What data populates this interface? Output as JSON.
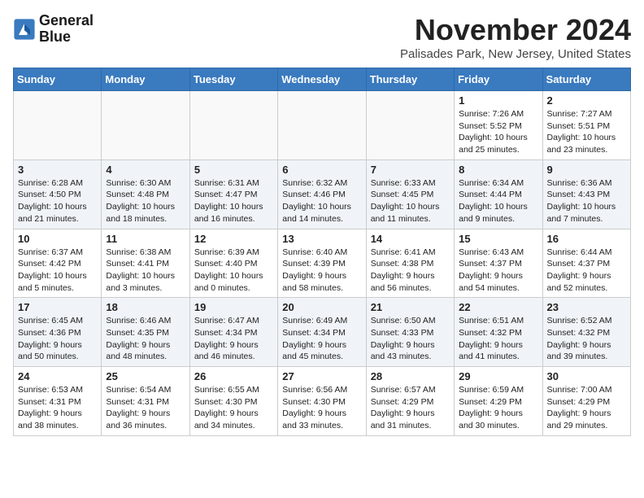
{
  "header": {
    "logo_line1": "General",
    "logo_line2": "Blue",
    "month_title": "November 2024",
    "location": "Palisades Park, New Jersey, United States"
  },
  "weekdays": [
    "Sunday",
    "Monday",
    "Tuesday",
    "Wednesday",
    "Thursday",
    "Friday",
    "Saturday"
  ],
  "weeks": [
    [
      {
        "day": "",
        "info": ""
      },
      {
        "day": "",
        "info": ""
      },
      {
        "day": "",
        "info": ""
      },
      {
        "day": "",
        "info": ""
      },
      {
        "day": "",
        "info": ""
      },
      {
        "day": "1",
        "info": "Sunrise: 7:26 AM\nSunset: 5:52 PM\nDaylight: 10 hours and 25 minutes."
      },
      {
        "day": "2",
        "info": "Sunrise: 7:27 AM\nSunset: 5:51 PM\nDaylight: 10 hours and 23 minutes."
      }
    ],
    [
      {
        "day": "3",
        "info": "Sunrise: 6:28 AM\nSunset: 4:50 PM\nDaylight: 10 hours and 21 minutes."
      },
      {
        "day": "4",
        "info": "Sunrise: 6:30 AM\nSunset: 4:48 PM\nDaylight: 10 hours and 18 minutes."
      },
      {
        "day": "5",
        "info": "Sunrise: 6:31 AM\nSunset: 4:47 PM\nDaylight: 10 hours and 16 minutes."
      },
      {
        "day": "6",
        "info": "Sunrise: 6:32 AM\nSunset: 4:46 PM\nDaylight: 10 hours and 14 minutes."
      },
      {
        "day": "7",
        "info": "Sunrise: 6:33 AM\nSunset: 4:45 PM\nDaylight: 10 hours and 11 minutes."
      },
      {
        "day": "8",
        "info": "Sunrise: 6:34 AM\nSunset: 4:44 PM\nDaylight: 10 hours and 9 minutes."
      },
      {
        "day": "9",
        "info": "Sunrise: 6:36 AM\nSunset: 4:43 PM\nDaylight: 10 hours and 7 minutes."
      }
    ],
    [
      {
        "day": "10",
        "info": "Sunrise: 6:37 AM\nSunset: 4:42 PM\nDaylight: 10 hours and 5 minutes."
      },
      {
        "day": "11",
        "info": "Sunrise: 6:38 AM\nSunset: 4:41 PM\nDaylight: 10 hours and 3 minutes."
      },
      {
        "day": "12",
        "info": "Sunrise: 6:39 AM\nSunset: 4:40 PM\nDaylight: 10 hours and 0 minutes."
      },
      {
        "day": "13",
        "info": "Sunrise: 6:40 AM\nSunset: 4:39 PM\nDaylight: 9 hours and 58 minutes."
      },
      {
        "day": "14",
        "info": "Sunrise: 6:41 AM\nSunset: 4:38 PM\nDaylight: 9 hours and 56 minutes."
      },
      {
        "day": "15",
        "info": "Sunrise: 6:43 AM\nSunset: 4:37 PM\nDaylight: 9 hours and 54 minutes."
      },
      {
        "day": "16",
        "info": "Sunrise: 6:44 AM\nSunset: 4:37 PM\nDaylight: 9 hours and 52 minutes."
      }
    ],
    [
      {
        "day": "17",
        "info": "Sunrise: 6:45 AM\nSunset: 4:36 PM\nDaylight: 9 hours and 50 minutes."
      },
      {
        "day": "18",
        "info": "Sunrise: 6:46 AM\nSunset: 4:35 PM\nDaylight: 9 hours and 48 minutes."
      },
      {
        "day": "19",
        "info": "Sunrise: 6:47 AM\nSunset: 4:34 PM\nDaylight: 9 hours and 46 minutes."
      },
      {
        "day": "20",
        "info": "Sunrise: 6:49 AM\nSunset: 4:34 PM\nDaylight: 9 hours and 45 minutes."
      },
      {
        "day": "21",
        "info": "Sunrise: 6:50 AM\nSunset: 4:33 PM\nDaylight: 9 hours and 43 minutes."
      },
      {
        "day": "22",
        "info": "Sunrise: 6:51 AM\nSunset: 4:32 PM\nDaylight: 9 hours and 41 minutes."
      },
      {
        "day": "23",
        "info": "Sunrise: 6:52 AM\nSunset: 4:32 PM\nDaylight: 9 hours and 39 minutes."
      }
    ],
    [
      {
        "day": "24",
        "info": "Sunrise: 6:53 AM\nSunset: 4:31 PM\nDaylight: 9 hours and 38 minutes."
      },
      {
        "day": "25",
        "info": "Sunrise: 6:54 AM\nSunset: 4:31 PM\nDaylight: 9 hours and 36 minutes."
      },
      {
        "day": "26",
        "info": "Sunrise: 6:55 AM\nSunset: 4:30 PM\nDaylight: 9 hours and 34 minutes."
      },
      {
        "day": "27",
        "info": "Sunrise: 6:56 AM\nSunset: 4:30 PM\nDaylight: 9 hours and 33 minutes."
      },
      {
        "day": "28",
        "info": "Sunrise: 6:57 AM\nSunset: 4:29 PM\nDaylight: 9 hours and 31 minutes."
      },
      {
        "day": "29",
        "info": "Sunrise: 6:59 AM\nSunset: 4:29 PM\nDaylight: 9 hours and 30 minutes."
      },
      {
        "day": "30",
        "info": "Sunrise: 7:00 AM\nSunset: 4:29 PM\nDaylight: 9 hours and 29 minutes."
      }
    ]
  ]
}
